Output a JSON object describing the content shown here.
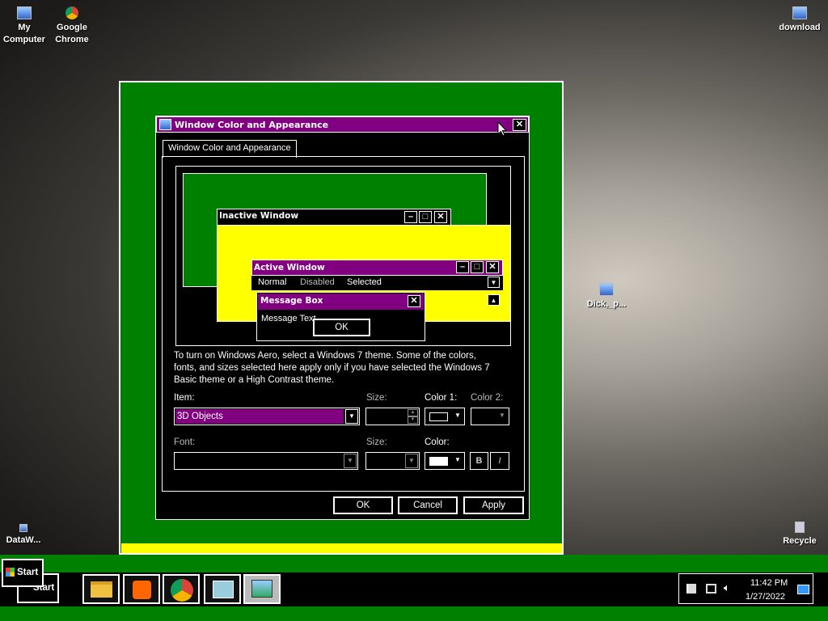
{
  "desktop": {
    "icons": [
      {
        "label": "My Computer",
        "icon": "computer-icon"
      },
      {
        "label": "Google Chrome",
        "icon": "chrome-icon"
      },
      {
        "label": "download",
        "icon": "image-file-icon"
      },
      {
        "label": "Dick,_p...",
        "icon": "image-file-icon"
      },
      {
        "label": "DataW...",
        "icon": "shortcut-icon"
      },
      {
        "label": "Recycle",
        "icon": "recycle-bin-icon"
      }
    ]
  },
  "dialog": {
    "title": "Window Color and Appearance",
    "tab": "Window Color and Appearance",
    "preview": {
      "inactive_title": "Inactive Window",
      "active_title": "Active Window",
      "menu": [
        "Normal",
        "Disabled",
        "Selected"
      ],
      "msgbox_title": "Message Box",
      "msgbox_text": "Message Text",
      "msgbox_ok": "OK"
    },
    "description": "To turn on Windows Aero, select a Windows 7 theme.  Some of the colors, fonts, and sizes selected here apply only if you have selected the Windows 7 Basic theme or a High Contrast theme.",
    "item_label": "Item:",
    "item_value": "3D Objects",
    "size_label": "Size:",
    "color1_label": "Color 1:",
    "color2_label": "Color 2:",
    "font_label": "Font:",
    "font_size_label": "Size:",
    "color_label": "Color:",
    "bold_label": "B",
    "italic_label": "I",
    "ok": "OK",
    "cancel": "Cancel",
    "apply": "Apply"
  },
  "taskbar": {
    "start": "Start",
    "start_tooltip": "Start",
    "time": "11:42 PM",
    "date": "1/27/2022"
  },
  "colors": {
    "highlight": "#800080",
    "frame": "#008000",
    "preview_window": "#ffff00"
  }
}
